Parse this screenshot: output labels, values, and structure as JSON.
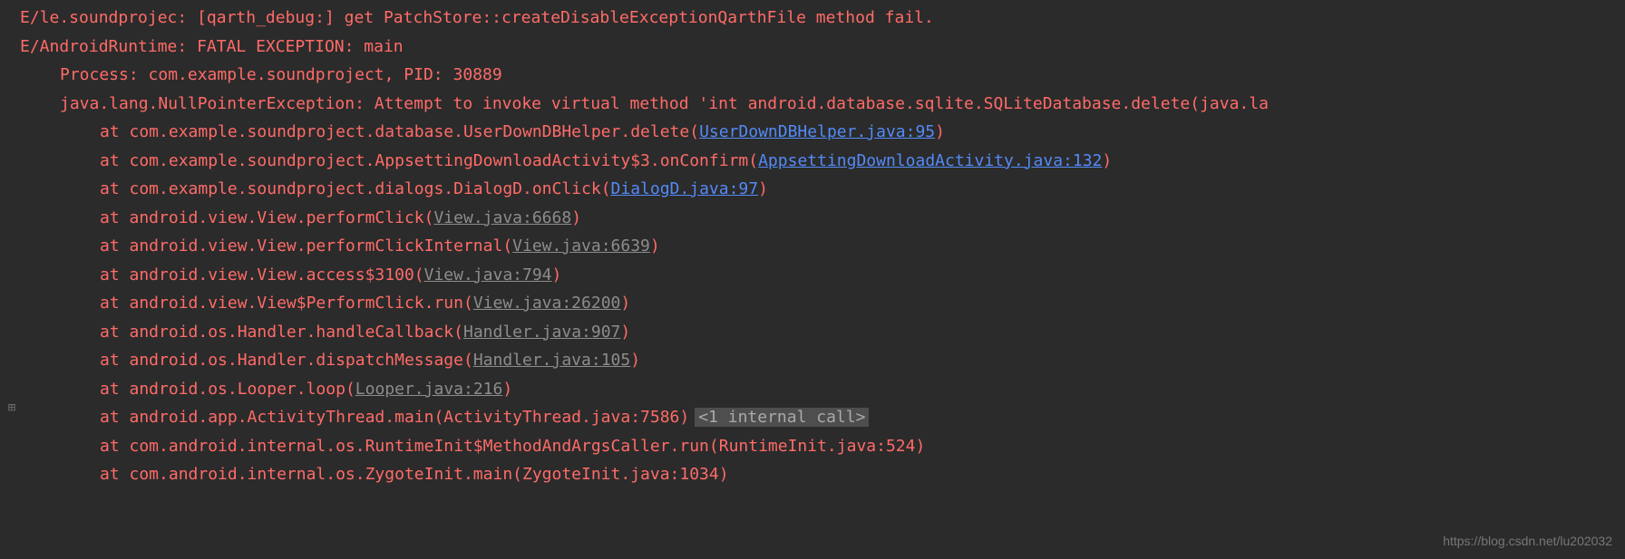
{
  "lines": {
    "l0": "E/le.soundprojec: [qarth_debug:]  get PatchStore::createDisableExceptionQarthFile method fail.",
    "l1": "E/AndroidRuntime: FATAL EXCEPTION: main",
    "l2": "Process: com.example.soundproject, PID: 30889",
    "l3": "java.lang.NullPointerException: Attempt to invoke virtual method 'int android.database.sqlite.SQLiteDatabase.delete(java.la",
    "l4_pre": "at com.example.soundproject.database.UserDownDBHelper.delete",
    "l4_link": "UserDownDBHelper.java:95",
    "l5_pre": "at com.example.soundproject.AppsettingDownloadActivity$3.onConfirm",
    "l5_link": "AppsettingDownloadActivity.java:132",
    "l6_pre": "at com.example.soundproject.dialogs.DialogD.onClick",
    "l6_link": "DialogD.java:97",
    "l7_pre": "at android.view.View.performClick",
    "l7_link": "View.java:6668",
    "l8_pre": "at android.view.View.performClickInternal",
    "l8_link": "View.java:6639",
    "l9_pre": "at android.view.View.access$3100",
    "l9_link": "View.java:794",
    "l10_pre": "at android.view.View$PerformClick.run",
    "l10_link": "View.java:26200",
    "l11_pre": "at android.os.Handler.handleCallback",
    "l11_link": "Handler.java:907",
    "l12_pre": "at android.os.Handler.dispatchMessage",
    "l12_link": "Handler.java:105",
    "l13_pre": "at android.os.Looper.loop",
    "l13_link": "Looper.java:216",
    "l14": "at android.app.ActivityThread.main(ActivityThread.java:7586)",
    "l14_badge": "<1 internal call>",
    "l15": "at com.android.internal.os.RuntimeInit$MethodAndArgsCaller.run(RuntimeInit.java:524)",
    "l16": "at com.android.internal.os.ZygoteInit.main(ZygoteInit.java:1034)"
  },
  "gutter_icon": "⊞",
  "watermark": "https://blog.csdn.net/lu202032"
}
